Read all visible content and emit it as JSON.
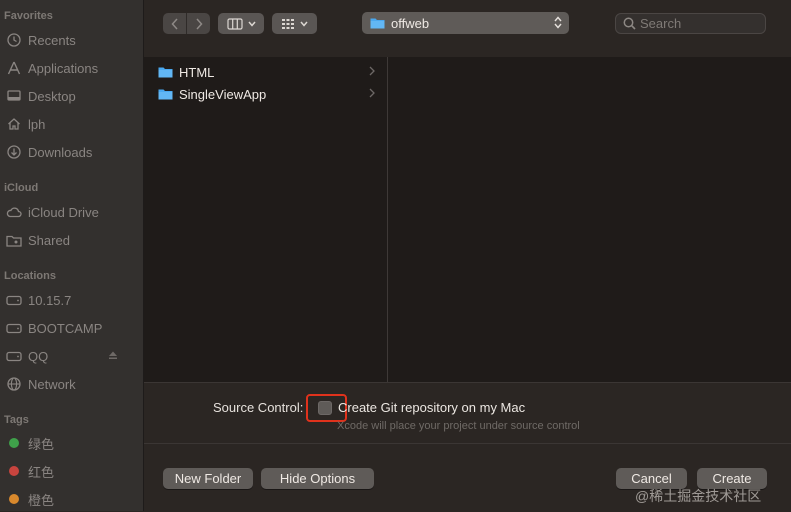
{
  "sidebar": {
    "favorites_heading": "Favorites",
    "favorites": [
      {
        "label": "Recents",
        "icon": "clock-icon"
      },
      {
        "label": "Applications",
        "icon": "applications-icon"
      },
      {
        "label": "Desktop",
        "icon": "desktop-icon"
      },
      {
        "label": "lph",
        "icon": "home-icon"
      },
      {
        "label": "Downloads",
        "icon": "download-icon"
      }
    ],
    "icloud_heading": "iCloud",
    "icloud": [
      {
        "label": "iCloud Drive",
        "icon": "cloud-icon"
      },
      {
        "label": "Shared",
        "icon": "shared-folder-icon"
      }
    ],
    "locations_heading": "Locations",
    "locations": [
      {
        "label": "10.15.7",
        "icon": "disk-icon"
      },
      {
        "label": "BOOTCAMP",
        "icon": "disk-icon"
      },
      {
        "label": "QQ",
        "icon": "disk-icon"
      },
      {
        "label": "Network",
        "icon": "network-icon"
      }
    ],
    "tags_heading": "Tags",
    "tags": [
      {
        "label": "绿色",
        "color": "#3fa14a"
      },
      {
        "label": "红色",
        "color": "#c8443e"
      },
      {
        "label": "橙色",
        "color": "#d9892d"
      }
    ]
  },
  "toolbar": {
    "location": "offweb",
    "search_placeholder": "Search"
  },
  "browser": {
    "items": [
      {
        "label": "HTML"
      },
      {
        "label": "SingleViewApp"
      }
    ]
  },
  "options": {
    "source_control_label": "Source Control:",
    "checkbox_label": "Create Git repository on my Mac",
    "checkbox_checked": false,
    "hint": "Xcode will place your project under source control"
  },
  "footer": {
    "new_folder": "New Folder",
    "hide_options": "Hide Options",
    "cancel": "Cancel",
    "create": "Create"
  },
  "watermark": "@稀土掘金技术社区",
  "colors": {
    "folder_blue": "#4aa8f0",
    "highlight_red": "#e0321c"
  }
}
